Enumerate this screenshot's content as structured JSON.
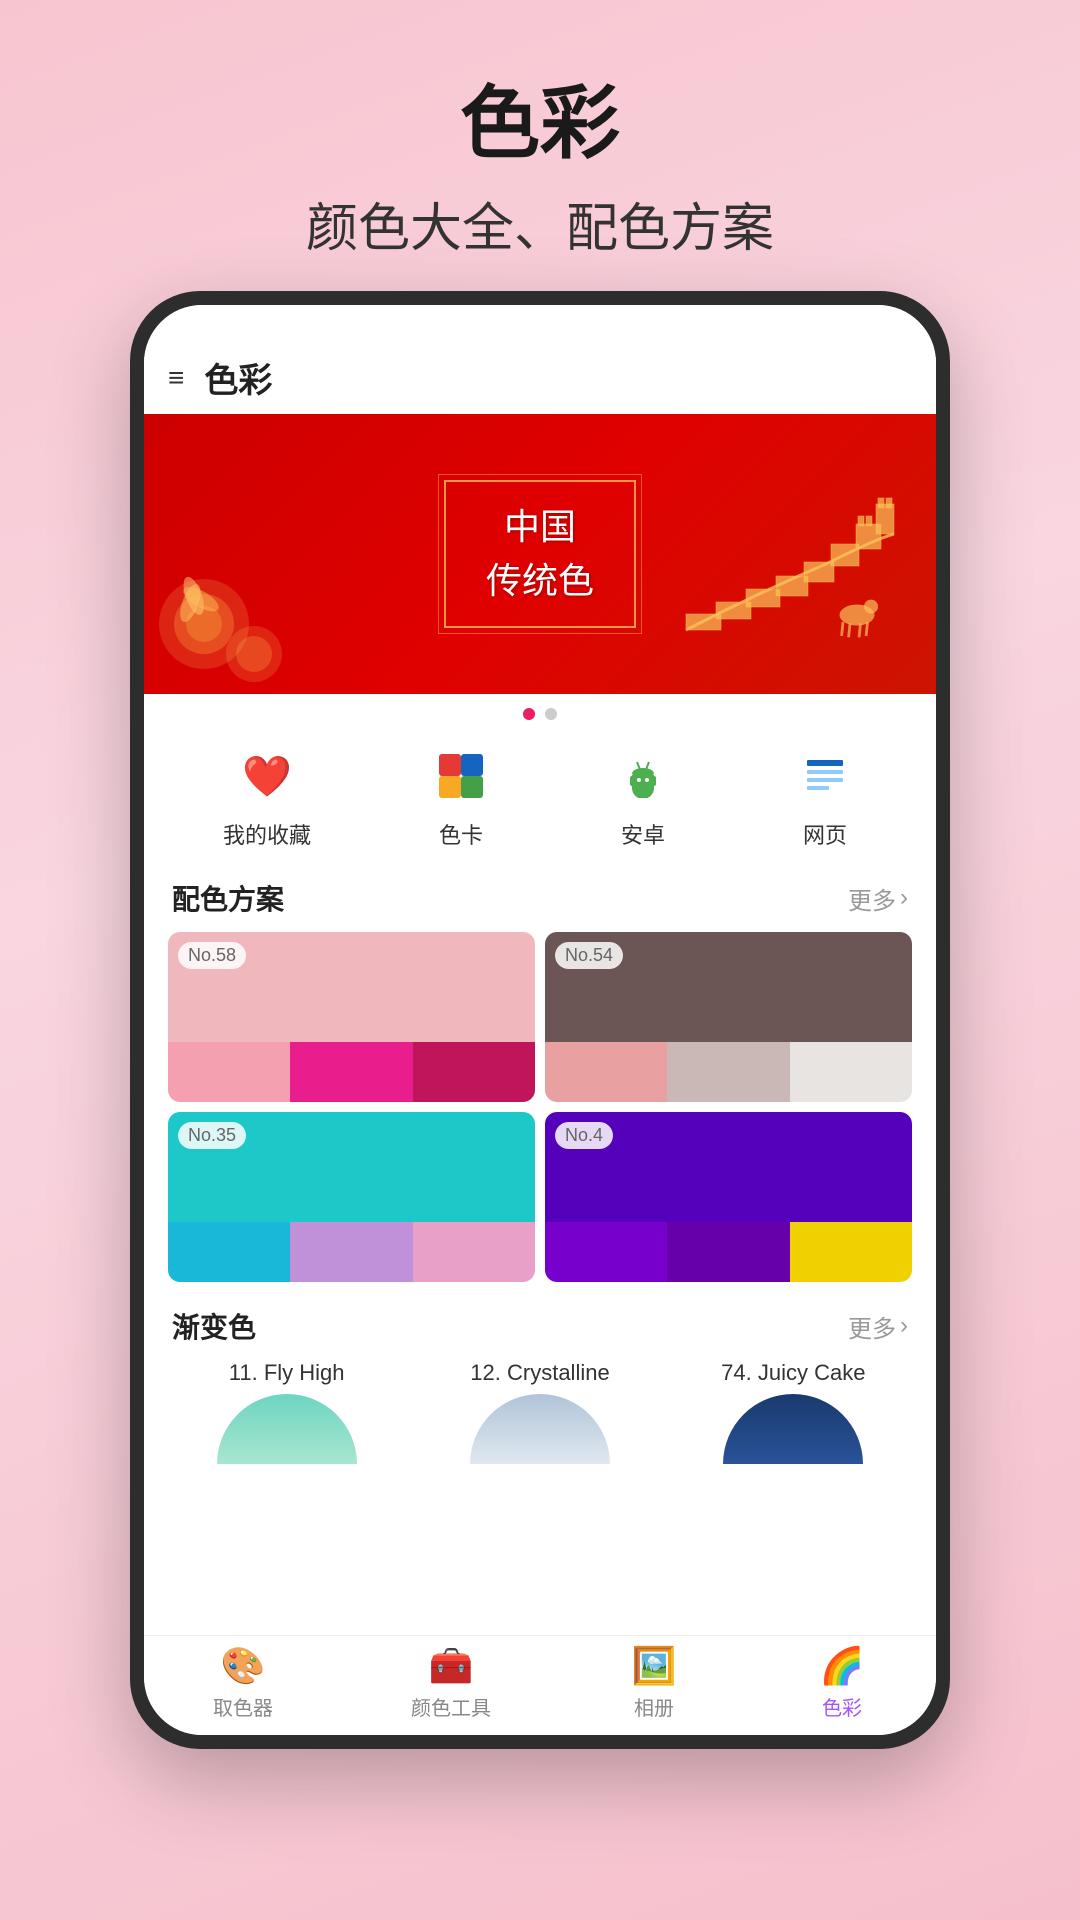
{
  "page": {
    "title": "色彩",
    "subtitle": "颜色大全、配色方案",
    "background_color": "#f7c5d0"
  },
  "app": {
    "header_title": "色彩",
    "hamburger": "≡"
  },
  "banner": {
    "line1": "中国",
    "line2": "传统色",
    "background": "#cc1a1a"
  },
  "dots": [
    {
      "active": true
    },
    {
      "active": false
    }
  ],
  "quick_nav": [
    {
      "icon": "❤️",
      "label": "我的收藏",
      "color": "#e91e63"
    },
    {
      "icon": "🎨",
      "label": "色卡",
      "color": "#e91e63"
    },
    {
      "icon": "🤖",
      "label": "安卓",
      "color": "#4caf50"
    },
    {
      "icon": "📄",
      "label": "网页",
      "color": "#1565c0"
    }
  ],
  "section_color_scheme": {
    "title": "配色方案",
    "more": "更多"
  },
  "color_schemes": [
    {
      "badge": "No.58",
      "main_color": "#f0b8bc",
      "swatches": [
        "#f4a0b0",
        "#e91e8c",
        "#c0155a"
      ]
    },
    {
      "badge": "No.54",
      "main_color": "#6b5555",
      "swatches": [
        "#e8a0a0",
        "#c9b8b5",
        "#e8e4e2"
      ]
    },
    {
      "badge": "No.35",
      "main_color": "#1cc8c8",
      "swatches": [
        "#1ab8d8",
        "#c090d8",
        "#e8a0c8"
      ]
    },
    {
      "badge": "No.4",
      "main_color": "#5500bb",
      "swatches": [
        "#7700cc",
        "#6600aa",
        "#f0d000"
      ]
    }
  ],
  "section_gradient": {
    "title": "渐变色",
    "more": "更多"
  },
  "gradient_items": [
    {
      "number": "11.",
      "name": "Fly High",
      "gradient_start": "#6dd5c0",
      "gradient_end": "#a8e6cf"
    },
    {
      "number": "12.",
      "name": "Crystalline",
      "gradient_start": "#c8d8e8",
      "gradient_end": "#e0e8f0"
    },
    {
      "number": "74.",
      "name": "Juicy Cake",
      "gradient_start": "#1a3a6e",
      "gradient_end": "#2a5298"
    }
  ],
  "bottom_nav": [
    {
      "icon": "🎨",
      "label": "取色器",
      "active": false
    },
    {
      "icon": "🧰",
      "label": "颜色工具",
      "active": false
    },
    {
      "icon": "🖼️",
      "label": "相册",
      "active": false
    },
    {
      "icon": "🌈",
      "label": "色彩",
      "active": true
    }
  ]
}
